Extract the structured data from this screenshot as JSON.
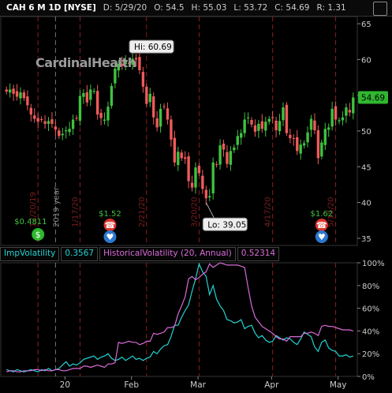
{
  "header": {
    "symbol": "CAH 6 M 1D [NYSE]",
    "date": "D: 5/29/20",
    "open": "O: 54.5",
    "high": "H: 55.03",
    "low": "L: 53.72",
    "close": "C: 54.69",
    "range": "R: 1.31"
  },
  "logo_text": "CardinalHealth",
  "chart_data": [
    {
      "type": "candlestick",
      "title": "",
      "y_ticks": [
        35,
        40,
        45,
        50,
        55,
        60,
        65
      ],
      "ylim": [
        34,
        66
      ],
      "x_labels": [
        "20",
        "Feb",
        "Mar",
        "Apr",
        "May"
      ],
      "last_price": "54.69",
      "annotations": {
        "high": "Hi: 60.69",
        "low": "Lo: 39.05",
        "dividend_1": "$1.52",
        "dividend_2": "$1.62",
        "earnings_1": "$0.4811",
        "vertical_date_labels": [
          "12/20/19",
          "1/17/20",
          "2/21/20",
          "3/20/20",
          "4/17/20",
          "5/15/20",
          "2019 year"
        ]
      },
      "closes": [
        55.5,
        55.8,
        55.2,
        54.8,
        55.4,
        54.6,
        53.6,
        52.3,
        51.7,
        51.3,
        51.6,
        51.0,
        51.4,
        51.0,
        50.2,
        49.3,
        49.6,
        50.1,
        50.3,
        51.6,
        51.8,
        54.9,
        55.3,
        54.0,
        55.8,
        55.6,
        52.3,
        51.8,
        51.6,
        53.4,
        56.3,
        58.7,
        59.4,
        59.1,
        59.9,
        59.4,
        60.1,
        60.0,
        58.5,
        56.2,
        53.8,
        55.2,
        51.9,
        50.5,
        53.1,
        53.4,
        51.6,
        48.8,
        45.6,
        47.1,
        46.2,
        46.1,
        43.0,
        42.1,
        44.9,
        44.1,
        41.9,
        40.6,
        40.9,
        45.6,
        45.3,
        48.0,
        47.4,
        45.4,
        47.2,
        47.7,
        49.3,
        49.7,
        51.6,
        51.9,
        50.9,
        49.9,
        51.0,
        50.3,
        51.3,
        51.7,
        51.8,
        50.1,
        51.4,
        53.3,
        49.7,
        49.0,
        48.9,
        47.2,
        48.1,
        48.3,
        49.8,
        51.7,
        50.1,
        46.2,
        48.4,
        50.3,
        50.5,
        53.1,
        51.6,
        51.5,
        51.9,
        53.3,
        52.6,
        54.69
      ]
    },
    {
      "type": "line",
      "title": "",
      "legend": [
        {
          "label": "ImpVolatility",
          "value": "0.3567"
        },
        {
          "label": "HistoricalVolatility (20, Annual)",
          "value": "0.52314"
        }
      ],
      "y_ticks": [
        "0%",
        "20%",
        "40%",
        "60%",
        "80%",
        "100%"
      ],
      "ylim": [
        0,
        100
      ],
      "series": [
        {
          "name": "ImpVolatility",
          "color": "#22d3d3",
          "values": [
            6,
            5,
            4,
            6,
            5,
            4,
            5,
            6,
            5,
            4,
            6,
            5,
            7,
            5,
            6,
            7,
            10,
            13,
            9,
            11,
            10,
            12,
            15,
            16,
            17,
            18,
            15,
            17,
            18,
            20,
            16,
            14,
            15,
            17,
            14,
            16,
            18,
            15,
            16,
            14,
            16,
            17,
            22,
            20,
            24,
            27,
            28,
            35,
            45,
            45,
            52,
            58,
            63,
            75,
            86,
            99,
            92,
            88,
            72,
            80,
            68,
            62,
            58,
            50,
            49,
            47,
            48,
            50,
            42,
            44,
            45,
            38,
            34,
            36,
            32,
            30,
            31,
            36,
            34,
            32,
            34,
            33,
            30,
            28,
            33,
            39,
            37,
            35,
            26,
            22,
            30,
            32,
            25,
            23,
            22,
            18,
            18,
            19,
            17,
            18
          ]
        },
        {
          "name": "HistoricalVolatility (20, Annual)",
          "color": "#d96bd9",
          "values": [
            4,
            5,
            5,
            4,
            4,
            5,
            5,
            5,
            6,
            6,
            5,
            6,
            5,
            5,
            6,
            6,
            5,
            5,
            6,
            7,
            7,
            7,
            9,
            9,
            8,
            9,
            10,
            9,
            8,
            11,
            11,
            12,
            30,
            29,
            30,
            31,
            30,
            30,
            28,
            29,
            31,
            31,
            38,
            37,
            38,
            39,
            43,
            43,
            44,
            55,
            62,
            70,
            86,
            88,
            85,
            87,
            90,
            92,
            99,
            96,
            98,
            100,
            99,
            98,
            98,
            98,
            98,
            97,
            96,
            78,
            62,
            52,
            48,
            44,
            42,
            40,
            38,
            35,
            33,
            33,
            31,
            35,
            35,
            35,
            35,
            38,
            38,
            39,
            38,
            36,
            44,
            45,
            44,
            44,
            43,
            42,
            41,
            41,
            41,
            40
          ]
        }
      ]
    }
  ]
}
